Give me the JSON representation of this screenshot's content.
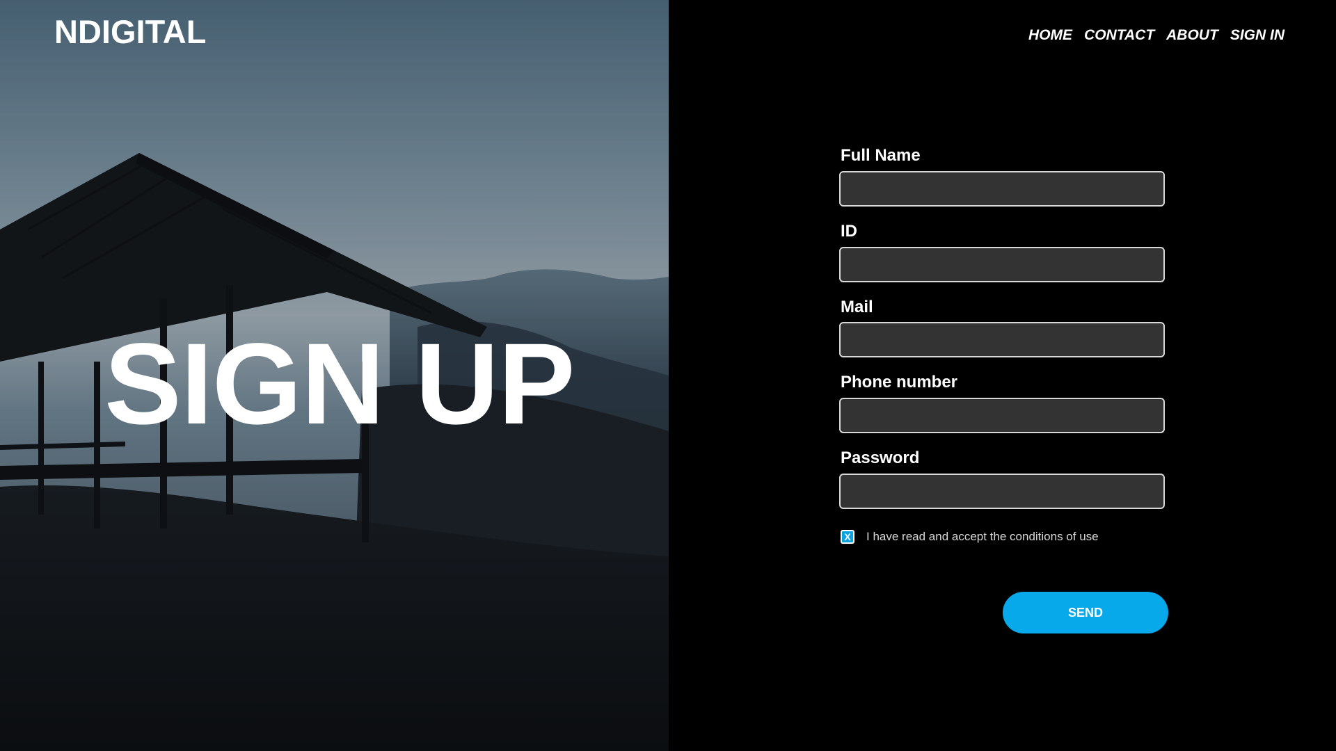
{
  "brand": {
    "name": "NDIGITAL"
  },
  "hero": {
    "title": "SIGN UP"
  },
  "nav": {
    "items": [
      {
        "label": "HOME"
      },
      {
        "label": "CONTACT"
      },
      {
        "label": "ABOUT"
      },
      {
        "label": "SIGN IN"
      }
    ]
  },
  "form": {
    "fields": [
      {
        "label": "Full Name",
        "value": ""
      },
      {
        "label": "ID",
        "value": ""
      },
      {
        "label": "Mail",
        "value": ""
      },
      {
        "label": "Phone number",
        "value": ""
      },
      {
        "label": "Password",
        "value": ""
      }
    ],
    "terms": {
      "checked": true,
      "check_mark": "X",
      "text": "I have read and accept the conditions of use"
    },
    "submit_label": "SEND"
  },
  "colors": {
    "accent": "#07a9ea",
    "panel_background": "#000000",
    "input_background": "#333333"
  }
}
